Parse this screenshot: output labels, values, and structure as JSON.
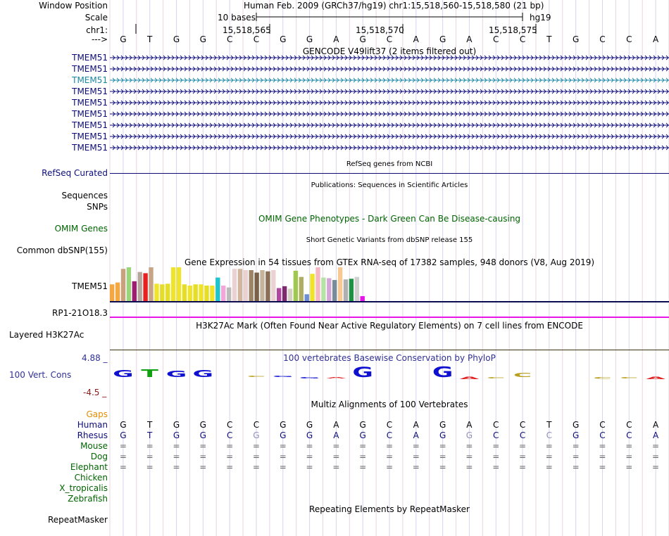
{
  "header": {
    "window_position_label": "Window Position",
    "window_position_value": "Human Feb. 2009 (GRCh37/hg19)   chr1:15,518,560-15,518,580 (21 bp)",
    "scale_label": "Scale",
    "scale_value": "10 bases",
    "scale_assembly": "hg19",
    "chrom_label": "chr1:",
    "tick_labels": [
      "15,518,565",
      "15,518,570",
      "15,518,575"
    ],
    "strand_label": "--->",
    "bases": [
      "G",
      "T",
      "G",
      "G",
      "C",
      "C",
      "G",
      "G",
      "A",
      "G",
      "C",
      "A",
      "G",
      "A",
      "C",
      "C",
      "T",
      "G",
      "C",
      "C",
      "A"
    ]
  },
  "gencode": {
    "title": "GENCODE V49lift37 (2 items filtered out)",
    "items": [
      "TMEM51",
      "TMEM51",
      "TMEM51",
      "TMEM51",
      "TMEM51",
      "TMEM51",
      "TMEM51",
      "TMEM51",
      "TMEM51"
    ],
    "highlight_index": 2,
    "color": "#0c0c78",
    "highlight_color": "#1a87a3"
  },
  "refseq": {
    "title": "RefSeq genes from NCBI",
    "label": "RefSeq Curated",
    "color": "#0c0c78"
  },
  "publications": {
    "title": "Publications: Sequences in Scientific Articles",
    "label_sequences": "Sequences",
    "label_snps": "SNPs"
  },
  "omim": {
    "title": "OMIM Gene Phenotypes - Dark Green Can Be Disease-causing",
    "label": "OMIM Genes",
    "color": "#006400"
  },
  "dbsnp": {
    "title": "Short Genetic Variants from dbSNP release 155",
    "label": "Common dbSNP(155)"
  },
  "gtex": {
    "title": "Gene Expression in 54 tissues from GTEx RNA-seq of 17382 samples, 948 donors (V8, Aug 2019)",
    "label": "TMEM51",
    "label2": "RP1-21O18.3",
    "colors": [
      "#f5a742",
      "#f5a742",
      "#c7a27c",
      "#9ad57c",
      "#9c1f6f",
      "#b6a79c",
      "#e82020",
      "#c8a486",
      "#f0e42a",
      "#e6de24",
      "#e6de24",
      "#f0e42a",
      "#f0e42a",
      "#e6de24",
      "#f0e42a",
      "#e6de24",
      "#f0e42a",
      "#e6de24",
      "#f0e42a",
      "#1fc4cc",
      "#f3a6d9",
      "#bbbbbb",
      "#ead2d2",
      "#d0b69f",
      "#ead2d2",
      "#9c8466",
      "#7a6248",
      "#c5b49c",
      "#8a6e55",
      "#ead2d2",
      "#b048a2",
      "#7d2a6f",
      "#d6cfc4",
      "#a0c84f",
      "#aeae62",
      "#6b8fd6",
      "#f0e42a",
      "#f5b8c3",
      "#b7e2a7",
      "#d4a6d8",
      "#7a8c9a",
      "#f8c992",
      "#b0b0b0",
      "#1e8f45",
      "#cfcfcf",
      "#e814e8"
    ],
    "values": [
      0.27,
      0.3,
      0.52,
      0.55,
      0.32,
      0.47,
      0.45,
      0.55,
      0.28,
      0.27,
      0.28,
      0.55,
      0.55,
      0.27,
      0.25,
      0.27,
      0.27,
      0.25,
      0.25,
      0.38,
      0.25,
      0.22,
      0.52,
      0.52,
      0.5,
      0.5,
      0.46,
      0.5,
      0.48,
      0.5,
      0.21,
      0.24,
      0.2,
      0.49,
      0.39,
      0.11,
      0.44,
      0.55,
      0.38,
      0.37,
      0.34,
      0.57,
      0.35,
      0.36,
      0.39,
      0.08
    ]
  },
  "h3k27ac": {
    "title": "H3K27Ac Mark (Often Found Near Active Regulatory Elements) on 7 cell lines from ENCODE",
    "label": "Layered H3K27Ac"
  },
  "phylop": {
    "title": "100 vertebrates Basewise Conservation by PhyloP",
    "label": "100 Vert. Cons",
    "max_label": "4.88 _",
    "min_label": "-4.5 _",
    "title_color": "#303096",
    "max_color": "#303096",
    "min_color": "#8b1a1a",
    "scores": [
      2.4,
      2.6,
      2.2,
      2.3,
      0,
      0.4,
      0.1,
      -0.2,
      -0.3,
      3.4,
      0,
      0,
      3.5,
      -0.8,
      -0.5,
      1.4,
      0,
      0,
      -0.6,
      -0.5,
      -0.7
    ]
  },
  "multiz": {
    "title": "Multiz Alignments of 100 Vertebrates",
    "gaps_label": "Gaps",
    "gaps_color": "#e68c00",
    "species": [
      "Human",
      "Rhesus",
      "Mouse",
      "Dog",
      "Elephant",
      "Chicken",
      "X_tropicalis",
      "Zebrafish"
    ],
    "species_colors": [
      "#0c0c78",
      "#0c0c78",
      "#006400",
      "#006400",
      "#006400",
      "#006400",
      "#006400",
      "#006400"
    ],
    "rhesus_bases": [
      "G",
      "T",
      "G",
      "G",
      "C",
      "G",
      "G",
      "G",
      "A",
      "G",
      "C",
      "A",
      "G",
      "G",
      "C",
      "C",
      "C",
      "G",
      "C",
      "C",
      "A"
    ],
    "rhesus_diff": [
      false,
      false,
      false,
      false,
      false,
      true,
      false,
      false,
      false,
      false,
      false,
      false,
      false,
      true,
      false,
      false,
      true,
      false,
      false,
      false,
      false
    ],
    "eq_rows": 3,
    "eq_symbol": "="
  },
  "repeatmasker": {
    "title": "Repeating Elements by RepeatMasker",
    "label": "RepeatMasker"
  }
}
